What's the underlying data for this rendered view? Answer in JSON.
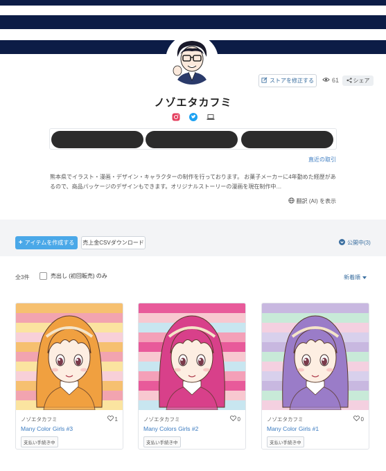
{
  "banner": {
    "stripe_color": "#0c1c46"
  },
  "header": {
    "shop_name": "ノゾエタカフミ",
    "store_edit_label": "ストアを修正する",
    "view_count": "61",
    "share_label": "シェア"
  },
  "socials": [
    "instagram-icon",
    "twitter-icon",
    "laptop-icon"
  ],
  "links": {
    "recent_transactions": "直近の取引"
  },
  "bio": {
    "text": "熊本県でイラスト・漫画・デザイン・キャラクターの制作を行っております。 お菓子メーカーに4年勤めた経歴があるので、商品パッケージのデザインもできます。オリジナルストーリーの漫画を現在制作中…",
    "translate_label": "翻訳 (AI) を表示"
  },
  "toolbar": {
    "create_label": "アイテムを作成する",
    "csv_label": "売上金CSVダウンロード",
    "public_label": "公開中(3)"
  },
  "filters": {
    "count_label": "全3件",
    "first_sale_label": "売出し (初回販売) のみ",
    "sort_label": "新着順"
  },
  "items": [
    {
      "author": "ノゾエタカフミ",
      "likes": "1",
      "title": "Many Color Girls #3",
      "status": "支払い手続き中",
      "hair": "#f0a040",
      "stripes": [
        "#f6c070",
        "#f2a4b0",
        "#fbe4a0",
        "#f8d0d8"
      ]
    },
    {
      "author": "ノゾエタカフミ",
      "likes": "0",
      "title": "Many Colors Girls #2",
      "status": "支払い手続き中",
      "hair": "#d8408a",
      "stripes": [
        "#e85a9a",
        "#f8c8d0",
        "#c8e6f0",
        "#f4a0b8"
      ]
    },
    {
      "author": "ノゾエタカフミ",
      "likes": "0",
      "title": "Many Color Girls #1",
      "status": "支払い手続き中",
      "hair": "#9a7cc8",
      "stripes": [
        "#c8b8e0",
        "#c8ead8",
        "#f4d0e0",
        "#d8d0ec"
      ]
    }
  ]
}
